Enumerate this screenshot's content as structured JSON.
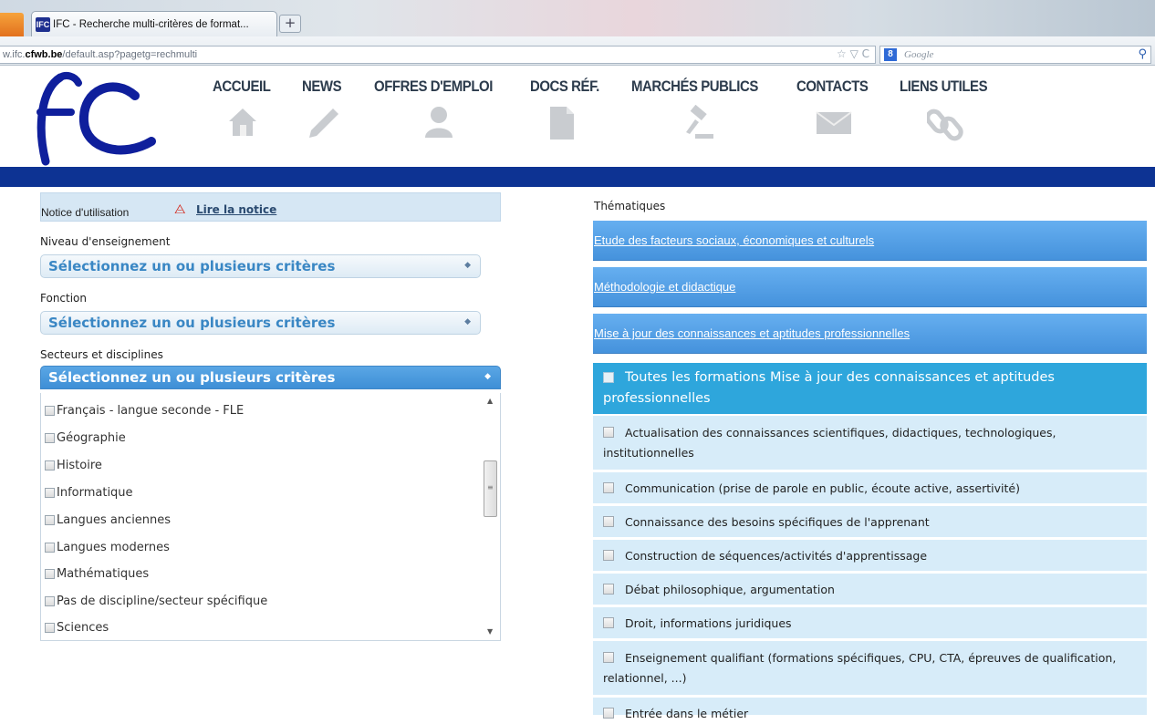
{
  "browser": {
    "tab_title": "IFC - Recherche multi-critères de format...",
    "favicon_text": "IFC",
    "new_tab": "+",
    "url_prefix": "w.ifc.",
    "url_domain": "cfwb.be",
    "url_path": "/default.asp?pagetg=rechmulti",
    "url_icons": "☆ ▽ C",
    "search_engine_badge": "8",
    "search_placeholder": "Google",
    "search_icon": "magnifier-icon"
  },
  "site": {
    "logo_alt": "IFC",
    "nav": [
      {
        "label": "ACCUEIL",
        "icon": "home-icon"
      },
      {
        "label": "NEWS",
        "icon": "pencil-icon"
      },
      {
        "label": "OFFRES D'EMPLOI",
        "icon": "person-icon"
      },
      {
        "label": "DOCS RÉF.",
        "icon": "document-icon"
      },
      {
        "label": "MARCHÉS PUBLICS",
        "icon": "gavel-icon"
      },
      {
        "label": "CONTACTS",
        "icon": "envelope-icon"
      },
      {
        "label": "LIENS UTILES",
        "icon": "chain-link-icon"
      }
    ],
    "colors": {
      "band": "#0d3393",
      "accent": "#3e8fd6",
      "teal": "#2ea6dc"
    }
  },
  "left": {
    "notice_label": "Notice d'utilisation",
    "notice_link": "Lire la notice",
    "niveau_label": "Niveau d'enseignement",
    "niveau_select": "Sélectionnez un ou plusieurs critères",
    "fonction_label": "Fonction",
    "fonction_select": "Sélectionnez un ou plusieurs critères",
    "secteurs_label": "Secteurs et disciplines",
    "secteurs_select": "Sélectionnez un ou plusieurs critères",
    "disciplines": [
      "Français - langue seconde - FLE",
      "Géographie",
      "Histoire",
      "Informatique",
      "Langues anciennes",
      "Langues modernes",
      "Mathématiques",
      "Pas de discipline/secteur spécifique",
      "Sciences"
    ]
  },
  "right": {
    "title": "Thématiques",
    "themes": [
      "Etude des facteurs sociaux, économiques et culturels",
      "Méthodologie et didactique",
      "Mise à jour des connaissances et aptitudes professionnelles"
    ],
    "all_label": "Toutes les formations Mise à jour des connaissances et aptitudes professionnelles",
    "subitems": [
      "Actualisation des connaissances scientifiques, didactiques, technologiques, institutionnelles",
      "Communication (prise de parole en public, écoute active, assertivité)",
      "Connaissance des besoins spécifiques de l'apprenant",
      "Construction de séquences/activités d'apprentissage",
      "Débat philosophique, argumentation",
      "Droit, informations juridiques",
      "Enseignement qualifiant (formations spécifiques, CPU, CTA, épreuves de qualification, relationnel, ...)",
      "Entrée dans le métier"
    ]
  }
}
